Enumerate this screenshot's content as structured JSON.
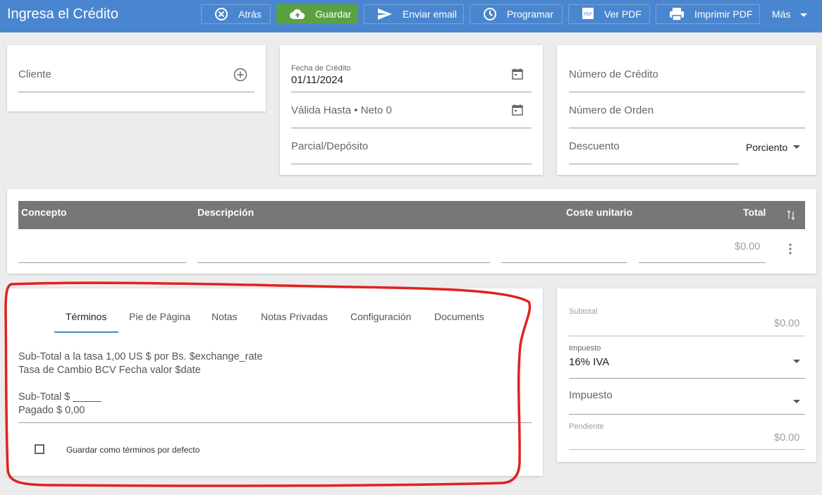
{
  "header": {
    "title": "Ingresa el Crédito",
    "buttons": {
      "back": "Atrás",
      "save": "Guardar",
      "email": "Enviar email",
      "schedule": "Programar",
      "view_pdf": "Ver PDF",
      "print_pdf": "Imprimir PDF",
      "more": "Más"
    }
  },
  "client": {
    "label": "Cliente"
  },
  "dates": {
    "credit_date_label": "Fecha de Crédito",
    "credit_date_value": "01/11/2024",
    "valid_until_label": "Válida Hasta • Neto 0",
    "partial_label": "Parcial/Depósito"
  },
  "numbers": {
    "credit_number_label": "Número de Crédito",
    "order_number_label": "Número de Orden",
    "discount_label": "Descuento",
    "discount_type": "Porciento"
  },
  "items_table": {
    "columns": [
      "Concepto",
      "Descripción",
      "Coste unitario",
      "Total"
    ],
    "row_total": "$0.00"
  },
  "tabs": [
    "Términos",
    "Pie de Página",
    "Notas",
    "Notas Privadas",
    "Configuración",
    "Documents"
  ],
  "terms": {
    "lines": [
      "Sub-Total a la tasa 1,00 US $ por Bs. $exchange_rate",
      "Tasa de Cambio BCV Fecha valor $date",
      "",
      "Sub-Total $ _____",
      "Pagado $ 0,00"
    ],
    "checkbox_label": "Guardar como términos por defecto"
  },
  "summary": {
    "subtotal_label": "Subtotal",
    "subtotal_value": "$0.00",
    "tax_label_small": "Impuesto",
    "tax_value": "16% IVA",
    "tax2_label": "Impuesto",
    "pending_label": "Pendiente",
    "pending_value": "$0.00"
  },
  "colors": {
    "header_bg": "#4a86cf",
    "save_bg": "#5aa142",
    "annotation_red": "#e0221f"
  }
}
